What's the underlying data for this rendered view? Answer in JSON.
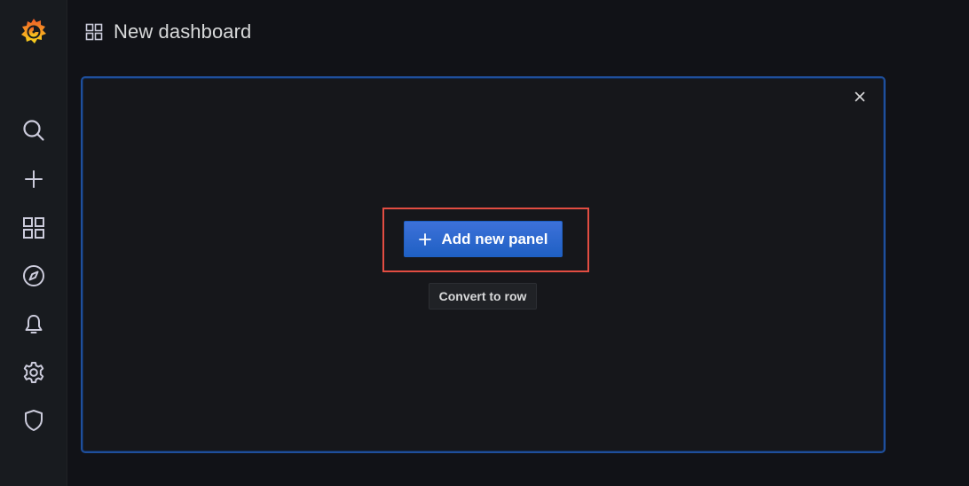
{
  "header": {
    "title": "New dashboard"
  },
  "sidebar": {
    "items": [
      {
        "icon": "search-icon"
      },
      {
        "icon": "plus-icon"
      },
      {
        "icon": "dashboards-icon"
      },
      {
        "icon": "compass-icon"
      },
      {
        "icon": "bell-icon"
      },
      {
        "icon": "gear-icon"
      },
      {
        "icon": "shield-icon"
      }
    ]
  },
  "panel": {
    "add_button_label": "Add new panel",
    "convert_button_label": "Convert to row"
  },
  "colors": {
    "accent": "#3d71d9",
    "highlight": "#e24d42",
    "background": "#111217",
    "sidebar": "#181b1f"
  }
}
